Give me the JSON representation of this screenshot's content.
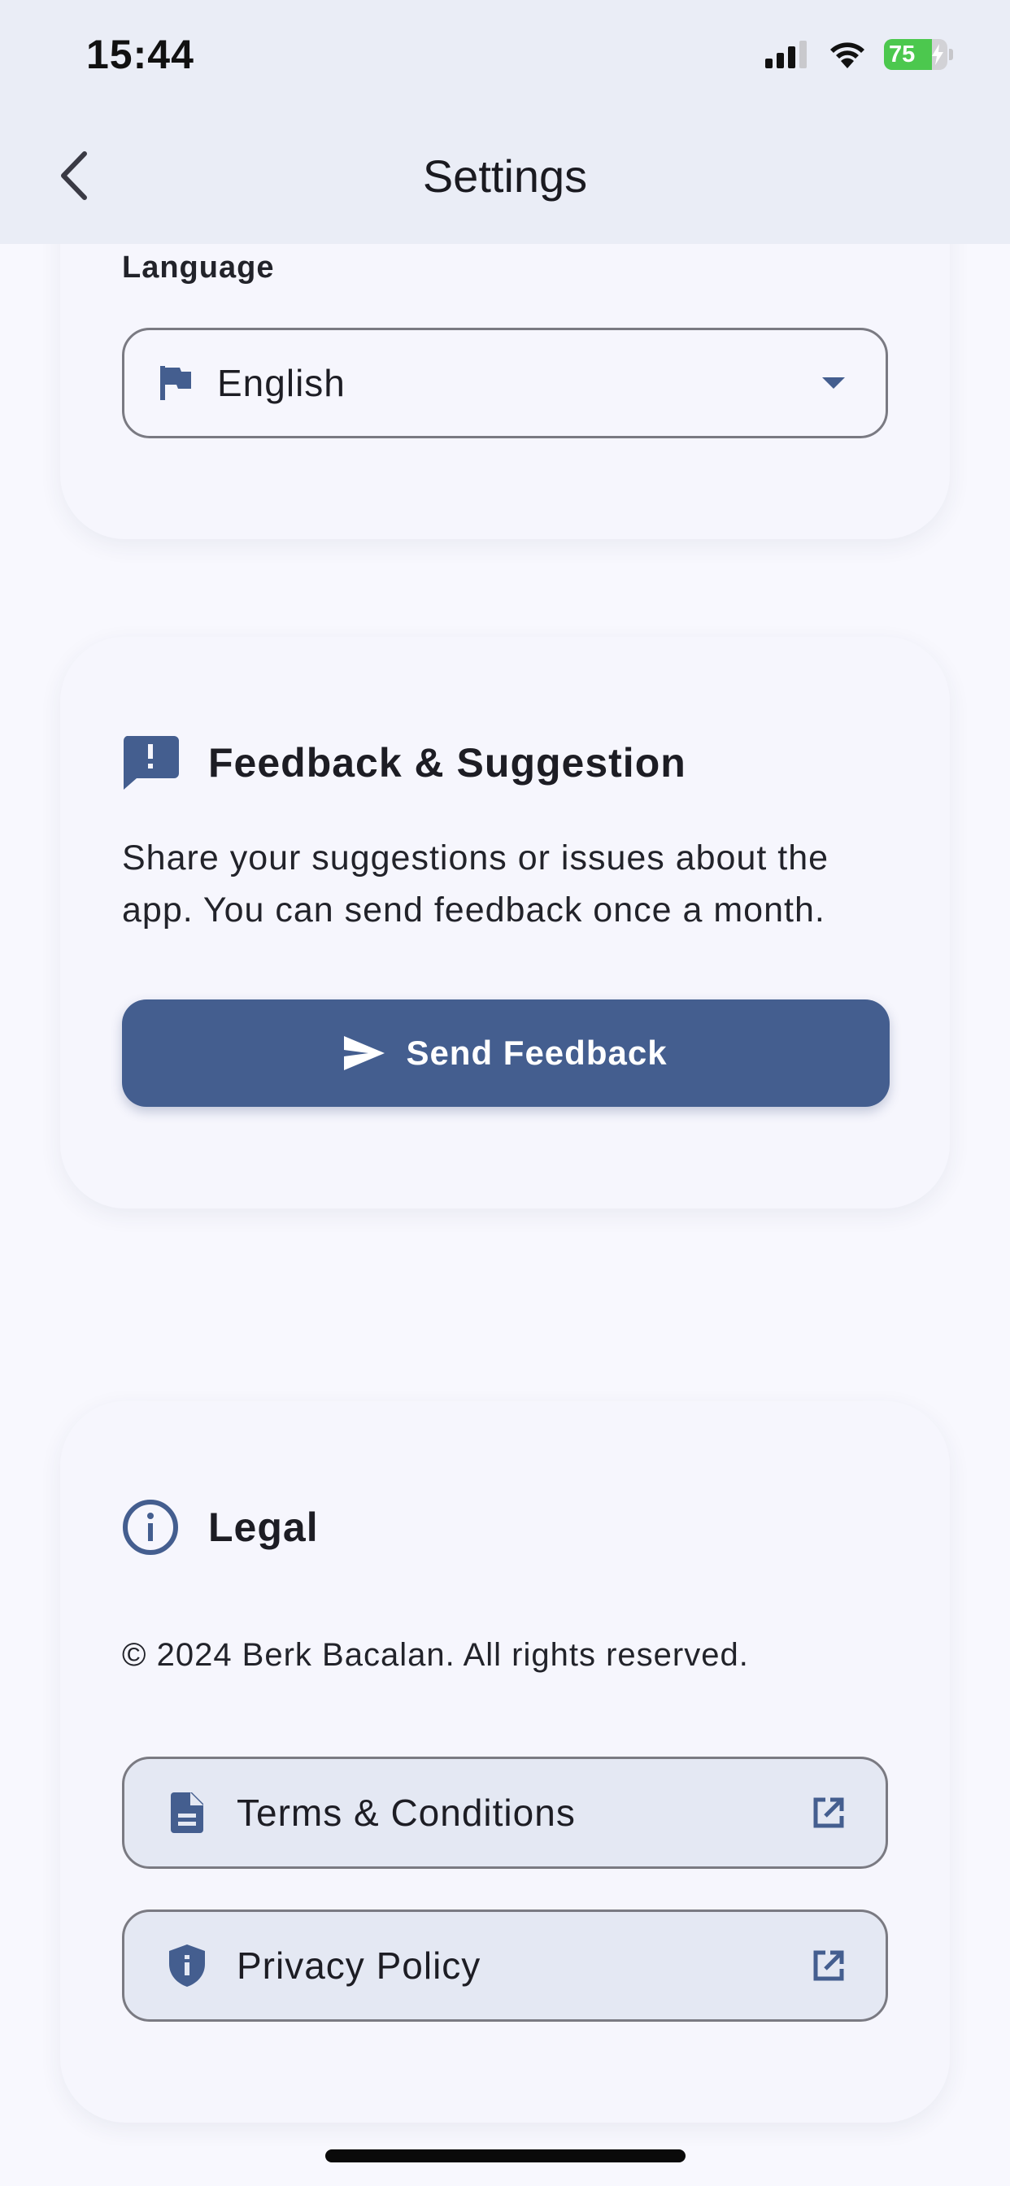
{
  "status_bar": {
    "time": "15:44",
    "battery_level": "75",
    "battery_fraction": 0.75,
    "icons": [
      "cellular-signal-icon",
      "wifi-icon",
      "battery-charging-icon"
    ]
  },
  "nav": {
    "title": "Settings",
    "back_icon": "chevron-left-icon"
  },
  "language_section": {
    "label": "Language",
    "selected": "English",
    "icon": "flag-icon"
  },
  "feedback_section": {
    "title": "Feedback & Suggestion",
    "description": "Share your suggestions or issues about the app. You can send feedback once a month.",
    "button_label": "Send Feedback",
    "icon": "feedback-icon"
  },
  "legal_section": {
    "title": "Legal",
    "copyright": "© 2024 Berk Bacalan. All rights reserved.",
    "links": [
      {
        "label": "Terms & Conditions",
        "icon": "document-icon"
      },
      {
        "label": "Privacy Policy",
        "icon": "shield-icon"
      }
    ]
  },
  "colors": {
    "accent": "#445e8f",
    "background": "#f8f8fe",
    "card": "#f6f6fd",
    "header": "#eaedf6",
    "link_fill": "#e4e8f3",
    "battery_green": "#4cc84e"
  }
}
